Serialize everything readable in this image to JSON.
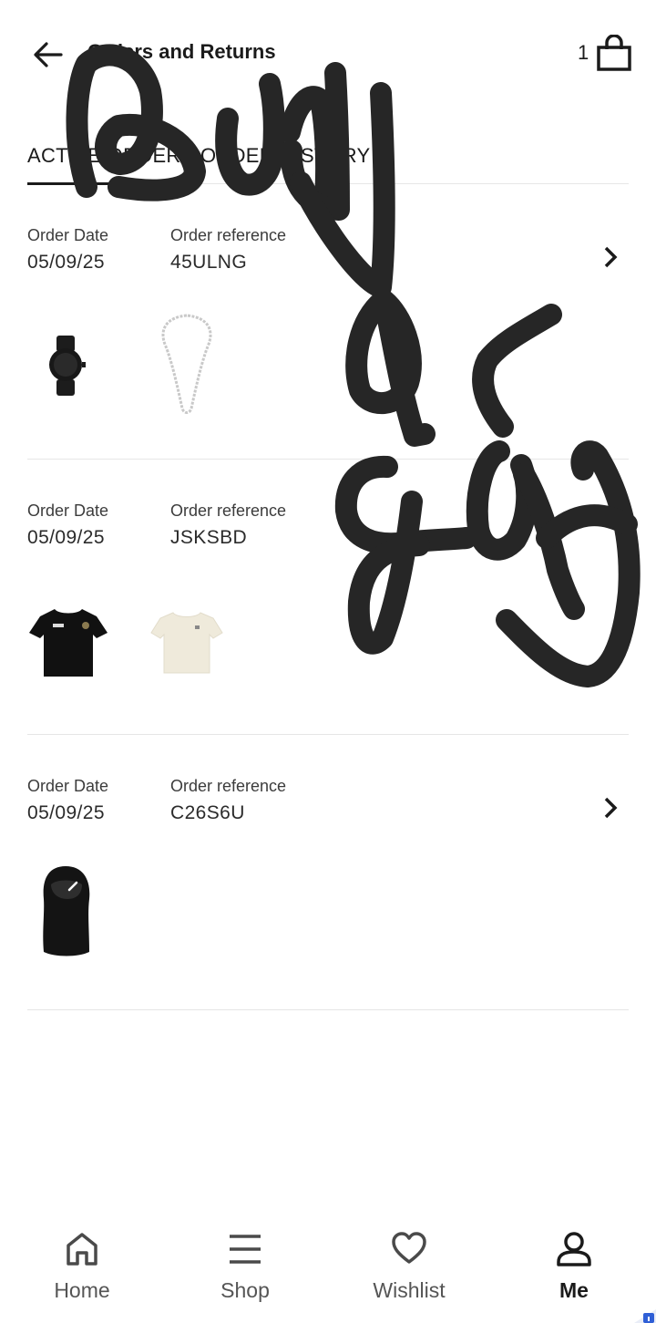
{
  "header": {
    "title": "Orders and Returns",
    "bag_count": "1",
    "back_icon": "arrow-left-icon",
    "bag_icon": "shopping-bag-icon"
  },
  "tabs": [
    {
      "label": "ACTIVE ORDERS",
      "active": true
    },
    {
      "label": "ORDER HISTORY",
      "active": false
    }
  ],
  "orders": [
    {
      "date_label": "Order Date",
      "date": "05/09/25",
      "ref_label": "Order reference",
      "ref": "45ULNG",
      "items": [
        "black watch",
        "silver chain necklace"
      ]
    },
    {
      "date_label": "Order Date",
      "date": "05/09/25",
      "ref_label": "Order reference",
      "ref": "JSKSBD",
      "items": [
        "black t-shirt",
        "cream t-shirt"
      ]
    },
    {
      "date_label": "Order Date",
      "date": "05/09/25",
      "ref_label": "Order reference",
      "ref": "C26S6U",
      "items": [
        "black balaclava"
      ]
    }
  ],
  "bottom_nav": [
    {
      "label": "Home",
      "icon": "home-icon",
      "active": false
    },
    {
      "label": "Shop",
      "icon": "menu-icon",
      "active": false
    },
    {
      "label": "Wishlist",
      "icon": "heart-icon",
      "active": false
    },
    {
      "label": "Me",
      "icon": "user-icon",
      "active": true
    }
  ],
  "colors": {
    "text": "#1b1b1b",
    "divider": "#e6e6e6",
    "active_pill": "#efefef",
    "scribble": "#262626"
  }
}
